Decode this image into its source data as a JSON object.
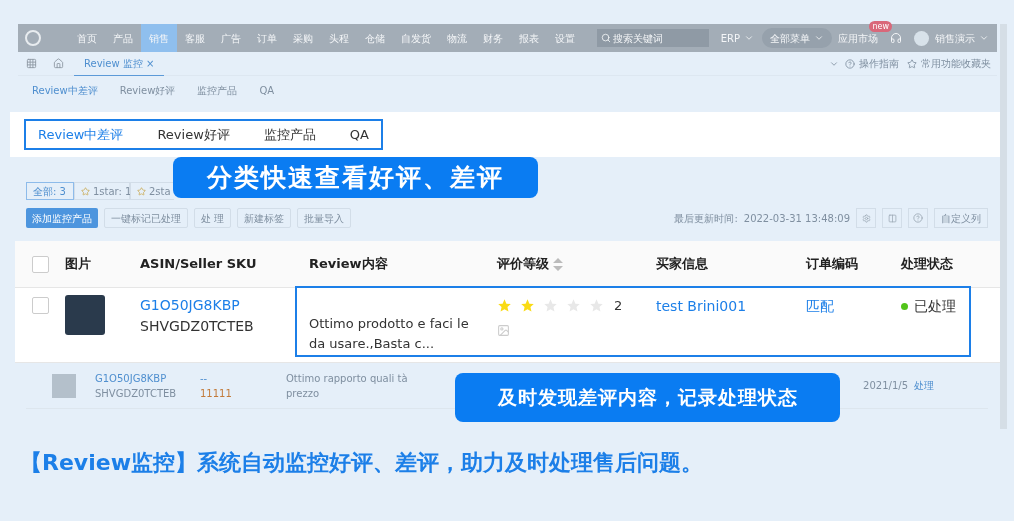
{
  "nav": {
    "items": [
      {
        "label": "首页",
        "selected": false
      },
      {
        "label": "产品",
        "selected": false
      },
      {
        "label": "销售",
        "selected": true
      },
      {
        "label": "客服",
        "selected": false
      },
      {
        "label": "广告",
        "selected": false
      },
      {
        "label": "订单",
        "selected": false
      },
      {
        "label": "采购",
        "selected": false
      },
      {
        "label": "头程",
        "selected": false
      },
      {
        "label": "仓储",
        "selected": false
      },
      {
        "label": "自发货",
        "selected": false
      },
      {
        "label": "物流",
        "selected": false
      },
      {
        "label": "财务",
        "selected": false
      },
      {
        "label": "报表",
        "selected": false
      },
      {
        "label": "设置",
        "selected": false
      }
    ],
    "search_placeholder": "搜索关键词",
    "erp": "ERP",
    "all_menu": "全部菜单",
    "app_market": "应用市场",
    "new_badge": "new",
    "user": "销售演示"
  },
  "page_tabs": [
    {
      "label": "Review 监控",
      "close": "×",
      "selected": true
    }
  ],
  "help": {
    "guide": "操作指南",
    "favorites": "常用功能收藏夹"
  },
  "sub_tabs": [
    {
      "label": "Review中差评",
      "selected": true
    },
    {
      "label": "Review好评",
      "selected": false
    },
    {
      "label": "监控产品",
      "selected": false
    },
    {
      "label": "QA",
      "selected": false
    }
  ],
  "highlight_tabs": [
    {
      "label": "Review中差评",
      "selected": true
    },
    {
      "label": "Review好评",
      "selected": false
    },
    {
      "label": "监控产品",
      "selected": false
    },
    {
      "label": "QA",
      "selected": false
    }
  ],
  "callout_top": "分类快速查看好评、差评",
  "filters": [
    {
      "label": "全部: 3",
      "star": false,
      "selected": true
    },
    {
      "label": "1star: 1",
      "star": true,
      "selected": false
    },
    {
      "label": "2sta",
      "star": true,
      "selected": false
    }
  ],
  "toolbar": {
    "buttons": [
      "添加监控产品",
      "一键标记已处理",
      "处 理",
      "新建标签",
      "批量导入"
    ],
    "updated_label": "最后更新时间:",
    "updated_value": "2022-03-31 13:48:09",
    "custom_columns": "自定义列"
  },
  "table": {
    "header_checked": false,
    "columns": [
      "图片",
      "ASIN/Seller SKU",
      "Review内容",
      "评价等级",
      "买家信息",
      "订单编码",
      "处理状态"
    ],
    "rows": [
      {
        "checked": false,
        "asin": "G1O50JG8KBP",
        "sku": "SHVGDZ0TCTEB",
        "review": "Ottimo prodotto e faci le da usare.,Basta c...",
        "stars": 2,
        "rating": "2",
        "buyer": "test Brini001",
        "order": "匹配",
        "status": "已处理",
        "color": "#52c41a"
      }
    ]
  },
  "faded_row": {
    "asin": "G1O50JG8KBP",
    "sku": "SHVGDZ0TCTEB",
    "dash": "--",
    "tag": "11111",
    "review": "Ottimo rapporto quali tà prezzo",
    "date": "2021/1/5",
    "action": "处理"
  },
  "callout_bottom": "及时发现差评内容，记录处理状态",
  "caption": "【Review监控】系统自动监控好评、差评，助力及时处理售后问题。"
}
